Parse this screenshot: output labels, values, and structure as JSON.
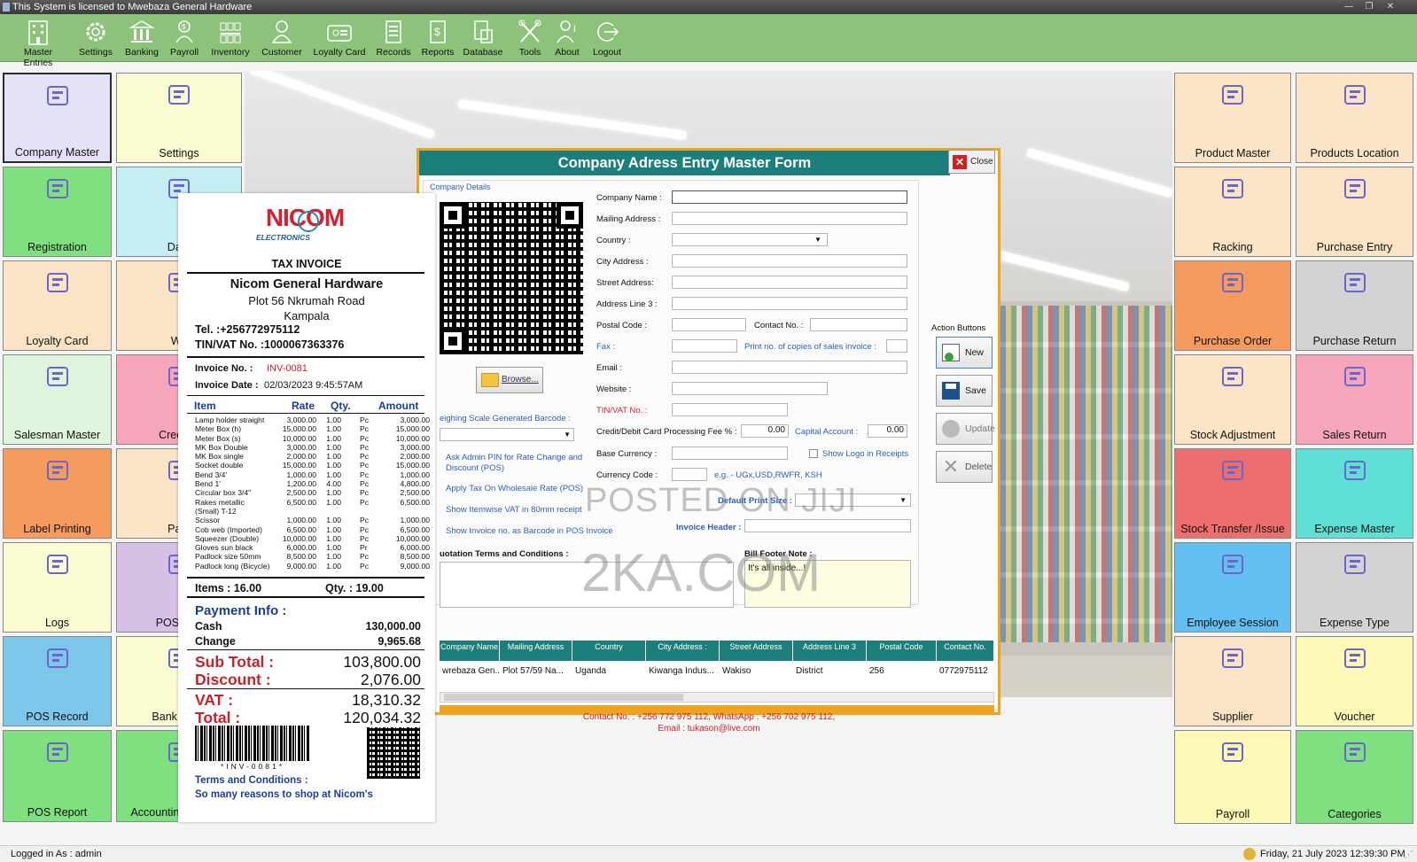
{
  "window": {
    "title": "This System is licensed to Mwebaza General Hardware"
  },
  "toolbar": [
    "Master Entries",
    "Settings",
    "Banking",
    "Payroll",
    "Inventory",
    "Customer",
    "Loyalty Card",
    "Records",
    "Reports",
    "Database",
    "Tools",
    "About",
    "Logout"
  ],
  "left_tiles": [
    "Company Master",
    "Settings",
    "Registration",
    "Data",
    "Loyalty Card",
    "Wa",
    "Salesman Master",
    "Credit C",
    "Label  Printing",
    "Payr",
    "Logs",
    "POS Wor",
    "POS Record",
    "Bank Reco",
    "POS Report",
    "Accounting Reports"
  ],
  "right_tiles": [
    "Product Master",
    "Products Location",
    "Racking",
    "Purchase Entry",
    "Purchase Order",
    "Purchase Return",
    "Stock  Adjustment",
    "Sales Return",
    "Stock Transfer /Issue",
    "Expense Master",
    "Employee Session",
    "Expense Type",
    "Supplier",
    "Voucher",
    "Payroll",
    "Categories"
  ],
  "tile_colors": {
    "lavender": "#e3e2f7",
    "cream": "#fbfbd2",
    "green": "#7fe07f",
    "cyan": "#c4eef2",
    "peach": "#fbe4c6",
    "pink": "#f7a5bb",
    "orange": "#f59b5d",
    "blue": "#7cc7ea",
    "mint": "#dff4dd",
    "purple": "#d6c0e6",
    "red": "#ee6d6d",
    "teal": "#5fe0d6",
    "sky": "#63bff2",
    "gray": "#d3d3d3",
    "yellow": "#fdf8b5"
  },
  "form": {
    "title": "Company Adress Entry Master Form",
    "close": "Close",
    "group": "Company Details",
    "browse": "Browse...",
    "labels": {
      "company_name": "Company Name :",
      "mailing": "Mailing Address :",
      "country": "Country :",
      "city": "City Address :",
      "street": "Street Address:",
      "line3": "Address Line 3 :",
      "postal": "Postal Code :",
      "contact": "Contact No. :",
      "fax": "Fax :",
      "copies": "Print no. of copies of sales invoice :",
      "email": "Email :",
      "website": "Website :",
      "tin": "TIN/VAT No. :",
      "fee": "Credit/Debit Card Processing Fee % :",
      "capital": "Capital Account :",
      "base": "Base Currency :",
      "logo": "Show Logo in Receipts",
      "code": "Currency Code :",
      "eg": "e.g. - UGx,USD,RWFR, KSH",
      "print_size": "Default Print Size :",
      "invoice_header": "Invoice Header :",
      "quotation": "uotation Terms and Conditions :",
      "bill_footer": "Bill Footer Note :",
      "weighing": "eighing Scale Generated Barcode :"
    },
    "fee_value": "0.00",
    "capital_value": "0.00",
    "bill_footer_text": "It's all inside...!",
    "options": [
      "Ask Admin PIN for Rate Change and Discount (POS)",
      "Apply Tax On Wholesale Rate (POS)",
      "Show Itemwise VAT in 80mm receipt",
      "Show Invoice no. as Barcode in POS Invoice"
    ],
    "action_title": "Action Buttons",
    "actions": [
      "New",
      "Save",
      "Update",
      "Delete"
    ],
    "grid_headers": [
      "Company Name",
      "Mailing Address",
      "Country",
      "City Address :",
      "Street Address",
      "Address Line 3",
      "Postal Code",
      "Contact No."
    ],
    "grid_row": [
      "wrebaza Gen...",
      "Plot 57/59 Na...",
      "Uganda",
      "Kiwanga Indus...",
      "Wakiso",
      "District",
      "256",
      "0772975112"
    ],
    "footer_contact": "Contact No. : +256 772 975 112, WhatsApp : +256 702 975 112,",
    "footer_email": "Email : tukason@live.com"
  },
  "receipt": {
    "logo": "NICOM",
    "logo_sub": "ELECTRONICS",
    "heading": "TAX INVOICE",
    "company": "Nicom General Hardware",
    "address1": "Plot 56 Nkrumah Road",
    "address2": "Kampala",
    "tel": "Tel. :+256772975112",
    "tin": "TIN/VAT No. :1000067363376",
    "inv_label": "Invoice No.  :",
    "inv_no": "INV-0081",
    "date_label": "Invoice Date :",
    "date": "02/03/2023   9:45:57AM",
    "cols": [
      "Item",
      "Rate",
      "Qty.",
      "Amount"
    ],
    "rows": [
      [
        "Lamp holder straight",
        "3,000.00",
        "1.00",
        "Pc",
        "3,000.00"
      ],
      [
        "Meter Box (h)",
        "15,000.00",
        "1.00",
        "Pc",
        "15,000.00"
      ],
      [
        "Meter Box (s)",
        "10,000.00",
        "1.00",
        "Pc",
        "10,000.00"
      ],
      [
        "MK Box Double",
        "3,000.00",
        "1.00",
        "Pc",
        "3,000.00"
      ],
      [
        "MK Box single",
        "2,000.00",
        "1.00",
        "Pc",
        "2,000.00"
      ],
      [
        "Socket double",
        "15,000.00",
        "1.00",
        "Pc",
        "15,000.00"
      ],
      [
        "Bend 3/4'",
        "1,000.00",
        "1.00",
        "Pc",
        "1,000.00"
      ],
      [
        "Bend 1'",
        "1,200.00",
        "4.00",
        "Pc",
        "4,800.00"
      ],
      [
        "Circular box 3/4\"",
        "2,500.00",
        "1.00",
        "Pc",
        "2,500.00"
      ],
      [
        "Rakes metallic",
        "6,500.00",
        "1.00",
        "Pc",
        "6,500.00"
      ],
      [
        "(Small) T-12",
        "",
        "",
        "",
        ""
      ],
      [
        "Scissor",
        "1,000.00",
        "1.00",
        "Pc",
        "1,000.00"
      ],
      [
        "Cob web (Imported)",
        "6,500.00",
        "1.00",
        "Pc",
        "6,500.00"
      ],
      [
        "Squeezer (Double)",
        "10,000.00",
        "1.00",
        "Pc",
        "10,000.00"
      ],
      [
        "Gloves sun black",
        "6,000.00",
        "1.00",
        "Pr",
        "6,000.00"
      ],
      [
        "Padlock size 50mm",
        "8,500.00",
        "1.00",
        "Pc",
        "8,500.00"
      ],
      [
        "Padlock long (Bicycle)",
        "9,000.00",
        "1.00",
        "Pc",
        "9,000.00"
      ]
    ],
    "items_count": "Items : 16.00",
    "qty_count": "Qty. : 19.00",
    "payment": "Payment Info :",
    "cash_label": "Cash",
    "cash": "130,000.00",
    "change_label": "Change",
    "change": "9,965.68",
    "subtotal_label": "Sub Total :",
    "subtotal": "103,800.00",
    "discount_label": "Discount :",
    "discount": "2,076.00",
    "vat_label": "VAT :",
    "vat": "18,310.32",
    "total_label": "Total :",
    "total": "120,034.32",
    "barcode_text": "*INV-0081*",
    "terms": "Terms and Conditions :",
    "slogan": "So many reasons to shop at Nicom's"
  },
  "watermark": {
    "line1": "POSTED ON JIJI",
    "line2": "2KA.COM"
  },
  "status": {
    "user": "Logged in As :  admin",
    "datetime": "Friday, 21 July 2023 12:39:30 PM"
  }
}
